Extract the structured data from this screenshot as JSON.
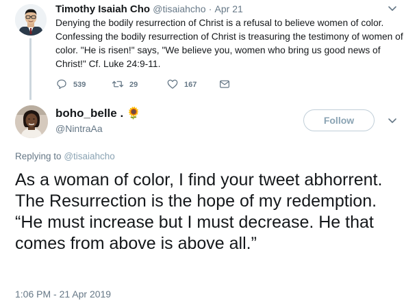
{
  "parent_tweet": {
    "name": "Timothy Isaiah Cho",
    "handle": "@tisaiahcho",
    "separator": "·",
    "date": "Apr 21",
    "text": "Denying the bodily resurrection of Christ is a refusal to believe women of color. Confessing the bodily resurrection of Christ is treasuring the testimony of women of color. \"He is risen!\" says, \"We believe you, women who bring us good news of Christ!\" Cf. Luke 24:9-11.",
    "replies": "539",
    "retweets": "29",
    "likes": "167",
    "icons": [
      "reply-icon",
      "retweet-icon",
      "like-icon",
      "message-icon",
      "chevron-down-icon"
    ]
  },
  "main_tweet": {
    "name": "boho_belle .",
    "name_emoji": "🌻",
    "handle": "@NintraAa",
    "follow_label": "Follow",
    "replying_prefix": "Replying to",
    "replying_handle": "@tisaiahcho",
    "text": "As a woman of color, I find your tweet abhorrent. The Resurrection is the hope of my redemption. “He must increase but I must decrease. He that comes from above is above all.”",
    "timestamp": "1:06 PM - 21 Apr 2019"
  },
  "colors": {
    "text": "#14171a",
    "secondary": "#657786",
    "thread_line": "#ccd6dd",
    "follow_border": "#c0ced8"
  }
}
